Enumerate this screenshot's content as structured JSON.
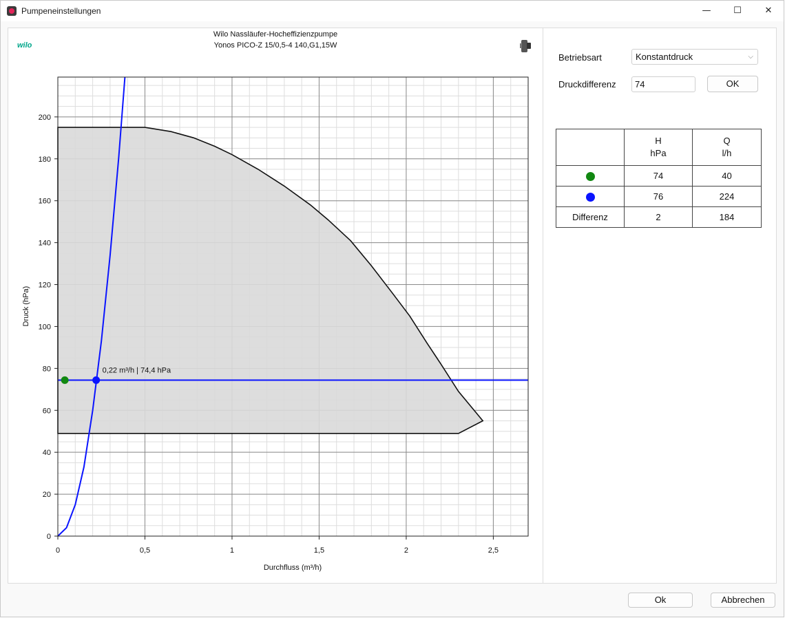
{
  "window": {
    "title": "Pumpeneinstellungen",
    "minimize_glyph": "—",
    "maximize_glyph": "☐",
    "close_glyph": "✕"
  },
  "brand": {
    "logo_text": "wilo"
  },
  "chart_header": {
    "line1": "Wilo Nassläufer-Hocheffizienzpumpe",
    "line2": "Yonos PICO-Z 15/0,5-4 140,G1,15W"
  },
  "settings": {
    "betriebsart_label": "Betriebsart",
    "betriebsart_value": "Konstantdruck",
    "druckdifferenz_label": "Druckdifferenz",
    "druckdifferenz_value": "74",
    "ok_label": "OK"
  },
  "table": {
    "headers": [
      {
        "top": "",
        "bottom": ""
      },
      {
        "top": "H",
        "bottom": "hPa"
      },
      {
        "top": "Q",
        "bottom": "l/h"
      }
    ],
    "rows": [
      {
        "marker_color": "#118811",
        "h": "74",
        "q": "40"
      },
      {
        "marker_color": "#0a14ff",
        "h": "76",
        "q": "224"
      },
      {
        "label": "Differenz",
        "h": "2",
        "q": "184"
      }
    ]
  },
  "footer": {
    "ok_label": "Ok",
    "cancel_label": "Abbrechen"
  },
  "colors": {
    "accent_blue": "#0a14ff",
    "green_marker": "#118811",
    "region_fill": "#d9d9d9",
    "brand_green": "#00a68a"
  },
  "chart_data": {
    "type": "line",
    "xlabel": "Durchfluss (m³/h)",
    "ylabel": "Druck (hPa)",
    "xlim": [
      0,
      2.7
    ],
    "ylim": [
      0,
      219
    ],
    "x_ticks": [
      {
        "value": 0,
        "label": "0"
      },
      {
        "value": 0.5,
        "label": "0,5"
      },
      {
        "value": 1,
        "label": "1"
      },
      {
        "value": 1.5,
        "label": "1,5"
      },
      {
        "value": 2,
        "label": "2"
      },
      {
        "value": 2.5,
        "label": "2,5"
      }
    ],
    "y_ticks": [
      {
        "value": 0,
        "label": "0"
      },
      {
        "value": 20,
        "label": "20"
      },
      {
        "value": 40,
        "label": "40"
      },
      {
        "value": 60,
        "label": "60"
      },
      {
        "value": 80,
        "label": "80"
      },
      {
        "value": 100,
        "label": "100"
      },
      {
        "value": 120,
        "label": "120"
      },
      {
        "value": 140,
        "label": "140"
      },
      {
        "value": 160,
        "label": "160"
      },
      {
        "value": 180,
        "label": "180"
      },
      {
        "value": 200,
        "label": "200"
      }
    ],
    "grid": true,
    "series": [
      {
        "kind": "region",
        "color": "#111111",
        "fill": "#d9d9d9",
        "points": [
          [
            0,
            195
          ],
          [
            0.5,
            195
          ],
          [
            0.65,
            193
          ],
          [
            0.78,
            190
          ],
          [
            0.9,
            186
          ],
          [
            1.0,
            182
          ],
          [
            1.15,
            175
          ],
          [
            1.3,
            167
          ],
          [
            1.45,
            158
          ],
          [
            1.55,
            151
          ],
          [
            1.68,
            141
          ],
          [
            1.8,
            129
          ],
          [
            1.92,
            116
          ],
          [
            2.02,
            105
          ],
          [
            2.12,
            92
          ],
          [
            2.2,
            82
          ],
          [
            2.3,
            69
          ],
          [
            2.38,
            61
          ],
          [
            2.44,
            55
          ],
          [
            2.3,
            49
          ],
          [
            0,
            49
          ]
        ]
      },
      {
        "kind": "curve",
        "color": "#0a14ff",
        "points": [
          [
            0,
            0
          ],
          [
            0.05,
            4
          ],
          [
            0.1,
            15
          ],
          [
            0.15,
            33
          ],
          [
            0.2,
            60
          ],
          [
            0.25,
            93
          ],
          [
            0.3,
            134
          ],
          [
            0.35,
            181
          ],
          [
            0.385,
            219
          ]
        ]
      },
      {
        "kind": "hline",
        "color": "#0a14ff",
        "y": 74.4
      }
    ],
    "markers": [
      {
        "x": 0.04,
        "y": 74.4,
        "color": "#118811"
      },
      {
        "x": 0.22,
        "y": 74.4,
        "color": "#0a14ff"
      }
    ],
    "annotation": {
      "x": 0.22,
      "y": 74.4,
      "text": "0,22 m³/h | 74,4 hPa"
    }
  }
}
